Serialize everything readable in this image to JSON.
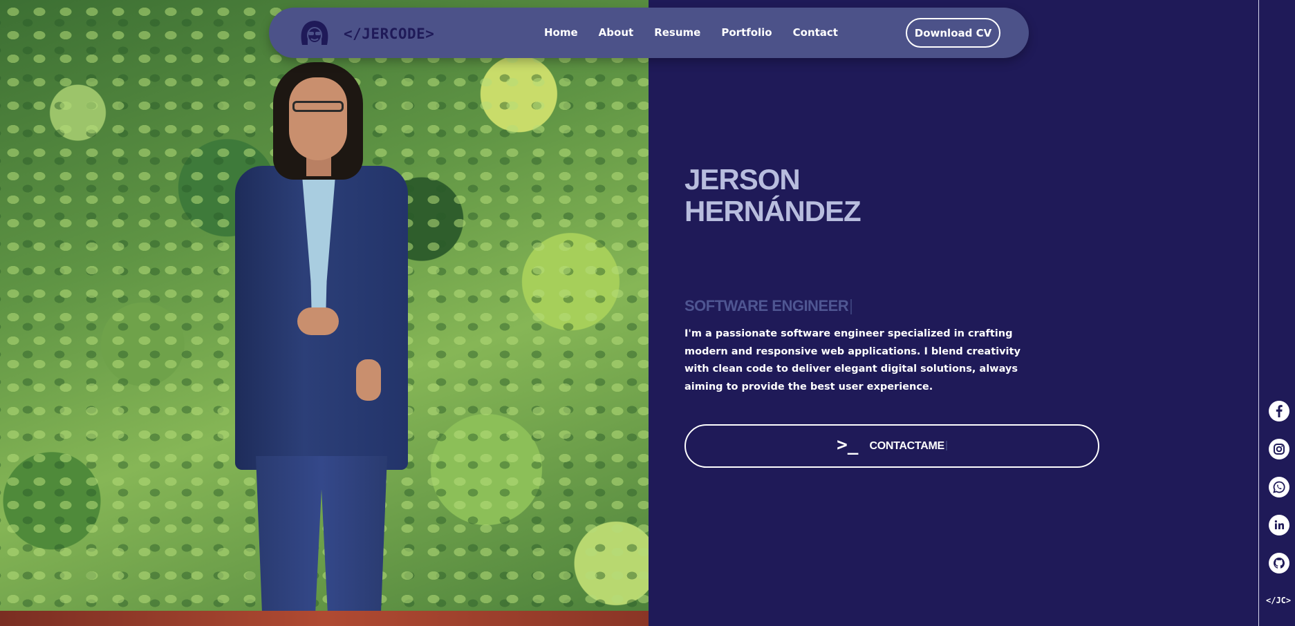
{
  "navbar": {
    "logo_text": "</JERCODE>",
    "links": [
      "Home",
      "About",
      "Resume",
      "Portfolio",
      "Contact"
    ],
    "download_label": "Download CV"
  },
  "hero": {
    "first_name": "JERSON",
    "last_name": "HERNÁNDEZ",
    "role": "SOFTWARE ENGINEER",
    "description": "I'm a passionate software engineer specialized in crafting modern and responsive web applications. I blend creativity with clean code to deliver elegant digital solutions, always aiming to provide the best user experience.",
    "contact_prompt": ">_",
    "contact_label": "CONTACTAME"
  },
  "sidebar": {
    "icons": [
      "facebook-icon",
      "instagram-icon",
      "whatsapp-icon",
      "linkedin-icon",
      "github-icon"
    ],
    "mark": "</JC>"
  },
  "colors": {
    "background": "#1f1a58",
    "navbar": "#4c5289",
    "name": "#b8bdde",
    "role": "#4f5692"
  }
}
